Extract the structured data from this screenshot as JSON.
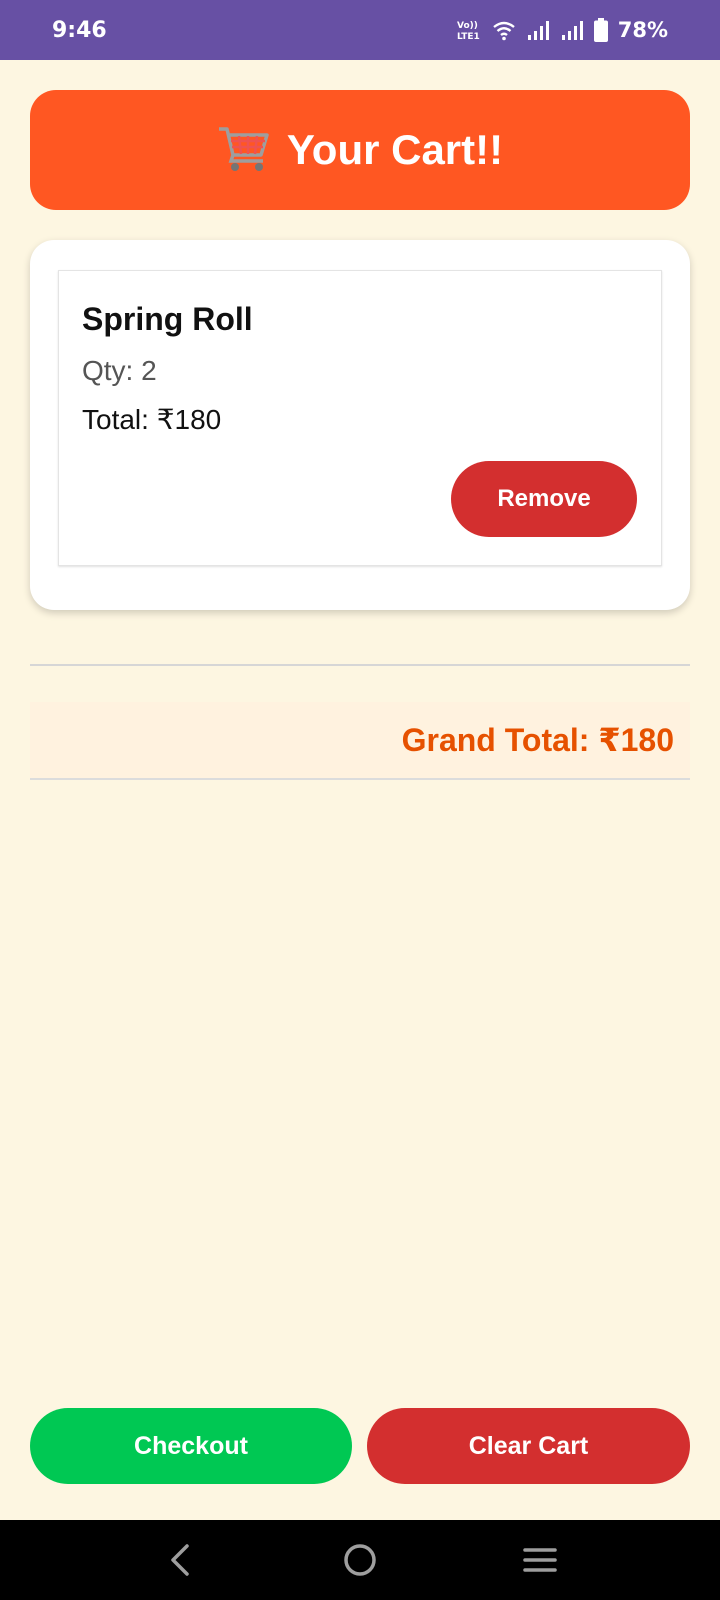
{
  "status_bar": {
    "time": "9:46",
    "battery_percent": "78%",
    "icons": [
      "volte-icon",
      "wifi-icon",
      "signal-icon",
      "signal-icon",
      "battery-icon"
    ]
  },
  "header": {
    "icon": "shopping-cart-icon",
    "title": "Your Cart!!"
  },
  "cart": {
    "items": [
      {
        "name": "Spring Roll",
        "qty_text": "Qty: 2",
        "total_text": "Total: ₹180",
        "remove_label": "Remove"
      }
    ]
  },
  "summary": {
    "grand_total_text": "Grand Total: ₹180"
  },
  "actions": {
    "checkout_label": "Checkout",
    "clear_label": "Clear Cart"
  },
  "nav": {
    "icons": [
      "back-icon",
      "home-icon",
      "menu-icon"
    ]
  },
  "colors": {
    "status_bar": "#6750a4",
    "header": "#ff5722",
    "background": "#fdf6e1",
    "remove": "#d32f2f",
    "checkout": "#00c853",
    "clear": "#d32f2f",
    "grand_total_text": "#e65100"
  }
}
